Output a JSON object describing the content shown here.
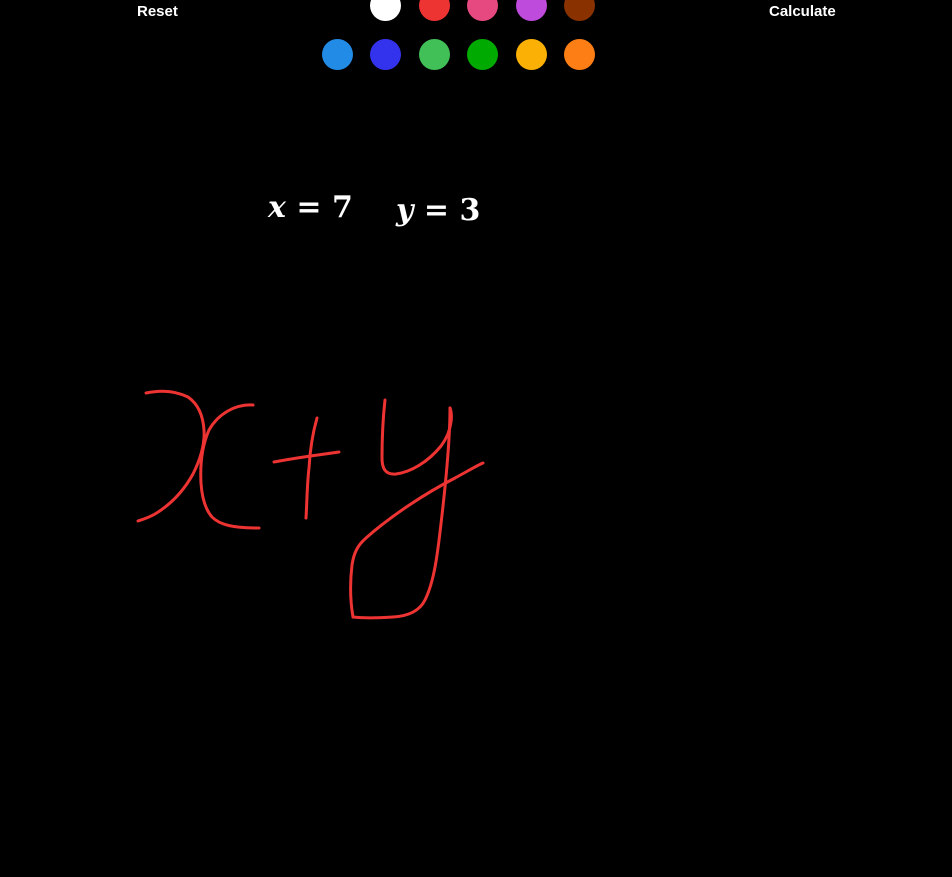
{
  "toolbar": {
    "reset_label": "Reset",
    "calculate_label": "Calculate"
  },
  "palette": [
    {
      "name": "black",
      "color": "#000000"
    },
    {
      "name": "white",
      "color": "#ffffff"
    },
    {
      "name": "red",
      "color": "#ee3333"
    },
    {
      "name": "pink",
      "color": "#e64980"
    },
    {
      "name": "purple",
      "color": "#be4bdb"
    },
    {
      "name": "brown",
      "color": "#893200"
    },
    {
      "name": "blue",
      "color": "#228be6"
    },
    {
      "name": "indigo",
      "color": "#3333ee"
    },
    {
      "name": "green",
      "color": "#40c057"
    },
    {
      "name": "dark-green",
      "color": "#00aa00"
    },
    {
      "name": "yellow",
      "color": "#fab005"
    },
    {
      "name": "orange",
      "color": "#fd7e14"
    }
  ],
  "variables": [
    {
      "name": "x",
      "equals": "=",
      "value": "7"
    },
    {
      "name": "y",
      "equals": "=",
      "value": "3"
    }
  ],
  "drawing": {
    "stroke_color": "#ee3333",
    "strokes": [
      "M146,393 C165,389 178,392 188,397 C198,404 203,415 204,430 C205,445 200,460 193,474 C183,492 170,505 155,514 C148,518 141,520 138,521",
      "M253,405 C235,404 218,414 209,430 C202,446 200,465 201,483 C202,498 205,509 212,517 C220,525 233,528 259,528",
      "M274,462 C290,459 310,456 325,454 L339,452",
      "M317,418 C313,432 310,450 309,468 C307,485 307,502 306,518",
      "M385,400 C383,418 382,438 382,458 C382,468 385,475 396,474 C411,472 428,462 441,446 C447,438 450,430 451,422 C452,416 451,410 450,408",
      "M450,408 C450,440 446,480 442,515 C438,550 435,580 425,600 C420,610 410,616 393,617 C378,618 362,618 353,617",
      "M353,617 C350,600 350,582 352,565 C354,552 358,545 366,538 C392,515 426,493 455,478 C468,471 476,466 483,463"
    ]
  }
}
